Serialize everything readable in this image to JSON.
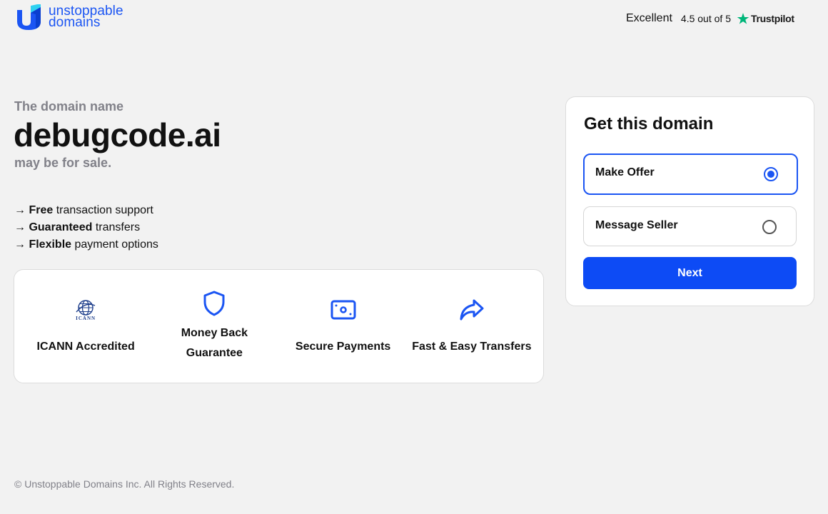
{
  "header": {
    "logo": {
      "line1": "unstoppable",
      "line2": "domains"
    },
    "rating": {
      "word": "Excellent",
      "score": "4.5 out of 5",
      "provider": "Trustpilot"
    }
  },
  "hero": {
    "eyebrow": "The domain name",
    "domain": "debugcode.ai",
    "subtitle": "may be for sale."
  },
  "features": [
    {
      "arrow": "→",
      "bold": "Free",
      "rest": " transaction support"
    },
    {
      "arrow": "→",
      "bold": "Guaranteed",
      "rest": " transfers"
    },
    {
      "arrow": "→",
      "bold": "Flexible",
      "rest": " payment options"
    }
  ],
  "benefits": [
    {
      "icon": "icann-globe-icon",
      "label": "ICANN Accredited",
      "sublabel": "ICANN"
    },
    {
      "icon": "shield-icon",
      "label_line1": "Money Back",
      "label_line2": "Guarantee"
    },
    {
      "icon": "payment-card-icon",
      "label": "Secure Payments"
    },
    {
      "icon": "share-arrow-icon",
      "label": "Fast & Easy Transfers"
    }
  ],
  "purchase": {
    "title": "Get this domain",
    "options": [
      {
        "label": "Make Offer",
        "selected": true
      },
      {
        "label": "Message Seller",
        "selected": false
      }
    ],
    "next_label": "Next"
  },
  "footer": {
    "copyright": "© Unstoppable Domains Inc. All Rights Reserved."
  },
  "colors": {
    "brand": "#1b55f3",
    "button": "#0d4bf5",
    "muted": "#818189",
    "background": "#f2f2f2",
    "trustpilot": "#00b67a"
  }
}
